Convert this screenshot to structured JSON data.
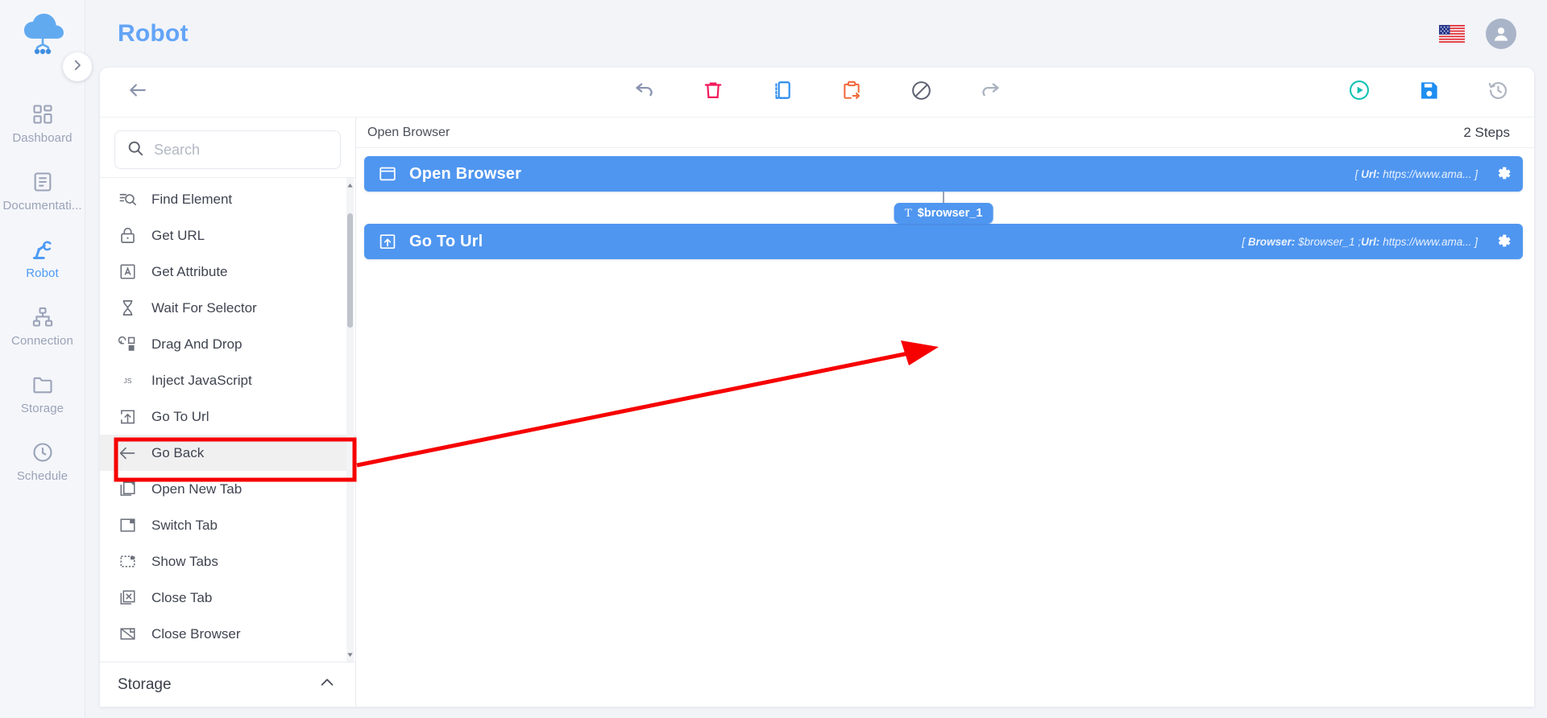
{
  "brand": {
    "logo_icon": "cloud-robot-logo"
  },
  "sidebar": {
    "toggle_icon": "chevron-right-icon",
    "items": [
      {
        "label": "Dashboard",
        "icon": "dashboard-grid-icon",
        "active": false
      },
      {
        "label": "Documentati...",
        "icon": "document-icon",
        "active": false
      },
      {
        "label": "Robot",
        "icon": "robot-arm-icon",
        "active": true
      },
      {
        "label": "Connection",
        "icon": "sitemap-icon",
        "active": false
      },
      {
        "label": "Storage",
        "icon": "folder-icon",
        "active": false
      },
      {
        "label": "Schedule",
        "icon": "clock-icon",
        "active": false
      }
    ]
  },
  "header": {
    "title": "Robot",
    "language_flag": "us-flag-icon",
    "account_icon": "user-avatar-icon"
  },
  "editor_toolbar": {
    "back_icon": "arrow-left-icon",
    "center_buttons": [
      {
        "name": "undo",
        "icon": "undo-icon",
        "color": "#8a94b0"
      },
      {
        "name": "delete",
        "icon": "trash-icon",
        "color": "#f2185b"
      },
      {
        "name": "copy",
        "icon": "duplicate-icon",
        "color": "#2e8df0"
      },
      {
        "name": "paste",
        "icon": "paste-arrow-icon",
        "color": "#f26a3c"
      },
      {
        "name": "disable",
        "icon": "block-icon",
        "color": "#5c6272"
      },
      {
        "name": "redo",
        "icon": "redo-icon",
        "color": "#9aa3b3"
      }
    ],
    "right_buttons": [
      {
        "name": "run",
        "icon": "play-circle-icon",
        "color": "#12c2b4"
      },
      {
        "name": "save",
        "icon": "floppy-save-icon",
        "color": "#1e8ef1"
      },
      {
        "name": "history",
        "icon": "history-icon",
        "color": "#aeb4c0"
      }
    ]
  },
  "library": {
    "search": {
      "placeholder": "Search",
      "value": "",
      "icon": "search-icon"
    },
    "items": [
      {
        "label": "Find Element",
        "icon": "find-element-icon",
        "highlighted": false
      },
      {
        "label": "Get URL",
        "icon": "lock-icon",
        "highlighted": false
      },
      {
        "label": "Get Attribute",
        "icon": "letter-a-box-icon",
        "highlighted": false
      },
      {
        "label": "Wait For Selector",
        "icon": "hourglass-icon",
        "highlighted": false
      },
      {
        "label": "Drag And Drop",
        "icon": "drag-drop-icon",
        "highlighted": false
      },
      {
        "label": "Inject JavaScript",
        "icon": "js-icon",
        "highlighted": false
      },
      {
        "label": "Go To Url",
        "icon": "go-to-url-icon",
        "highlighted": false
      },
      {
        "label": "Go Back",
        "icon": "arrow-left-icon",
        "highlighted": true
      },
      {
        "label": "Open New Tab",
        "icon": "new-tab-icon",
        "highlighted": false
      },
      {
        "label": "Switch Tab",
        "icon": "switch-tab-icon",
        "highlighted": false
      },
      {
        "label": "Show Tabs",
        "icon": "show-tabs-icon",
        "highlighted": false
      },
      {
        "label": "Close Tab",
        "icon": "close-tab-icon",
        "highlighted": false
      },
      {
        "label": "Close Browser",
        "icon": "close-browser-icon",
        "highlighted": false
      }
    ],
    "footer": {
      "label": "Storage",
      "chevron_icon": "chevron-up-icon"
    },
    "scrollbar": {
      "up_icon": "caret-up-icon",
      "down_icon": "caret-down-icon"
    }
  },
  "canvas": {
    "breadcrumb": "Open Browser",
    "step_count": "2 Steps",
    "steps": [
      {
        "name": "Open Browser",
        "icon": "browser-window-icon",
        "params_prefix": "[ ",
        "params": [
          {
            "key": "Url:",
            "value": "https://www.ama..."
          }
        ],
        "params_suffix": " ]",
        "gear_icon": "gear-icon"
      },
      {
        "name": "Go To Url",
        "icon": "go-to-url-icon",
        "params_prefix": "[ ",
        "params": [
          {
            "key": "Browser:",
            "value": "$browser_1"
          },
          {
            "key": "Url:",
            "value": "https://www.ama..."
          }
        ],
        "params_suffix": " ]",
        "gear_icon": "gear-icon"
      }
    ],
    "connector_variable": {
      "label": "$browser_1",
      "type_glyph": "T"
    }
  },
  "annotation": {
    "highlight_color": "#f60000",
    "arrow_color": "#f60000",
    "target_label": "Go Back"
  },
  "colors": {
    "accent_blue": "#4f96f0",
    "brand_blue": "#63a4f7",
    "page_bg": "#f2f4f8",
    "rail_bg": "#f5f6fa"
  }
}
